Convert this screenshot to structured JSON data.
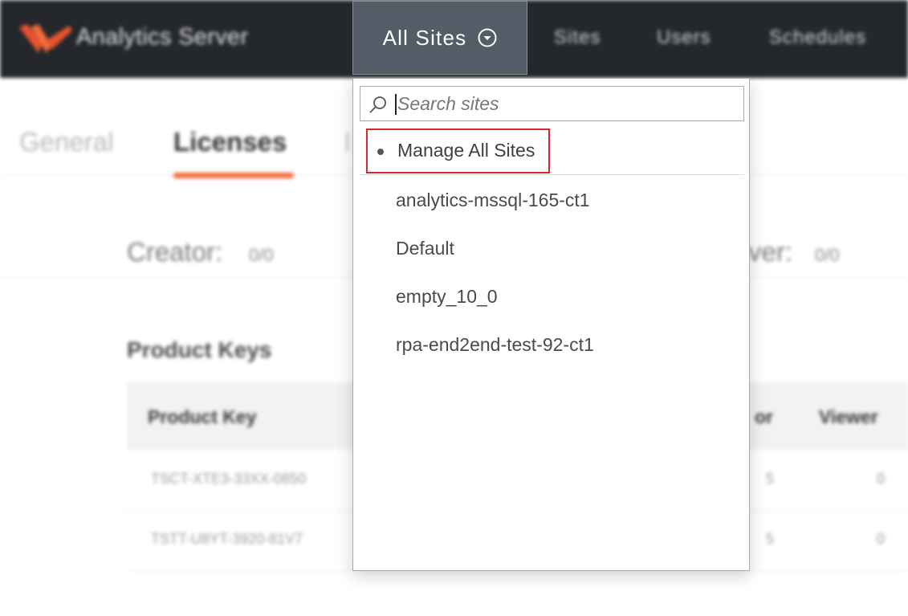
{
  "header": {
    "brand": "Analytics Server",
    "site_selector_label": "All Sites",
    "nav": [
      "Sites",
      "Users",
      "Schedules"
    ]
  },
  "tabs": {
    "general": "General",
    "licenses": "Licenses",
    "partial": "I"
  },
  "licenses": {
    "creator_label": "Creator:",
    "creator_value": "0/0",
    "viewer_label": "ver:",
    "viewer_value": "0/0"
  },
  "product_keys": {
    "title": "Product Keys",
    "headers": {
      "key": "Product Key",
      "creator": "or",
      "viewer": "Viewer"
    },
    "rows": [
      {
        "key": "TSCT-XTE3-33XX-0850",
        "creator": "5",
        "viewer": "0"
      },
      {
        "key": "TSTT-U8YT-3920-81V7",
        "creator": "5",
        "viewer": "0"
      }
    ]
  },
  "dropdown": {
    "search_placeholder": "Search sites",
    "manage_label": "Manage All Sites",
    "sites": [
      "analytics-mssql-165-ct1",
      "Default",
      "empty_10_0",
      "rpa-end2end-test-92-ct1"
    ]
  },
  "colors": {
    "accent": "#f26b3a",
    "highlight": "#d9262c",
    "header_bg": "#24272c",
    "trigger_bg": "#545d67"
  }
}
